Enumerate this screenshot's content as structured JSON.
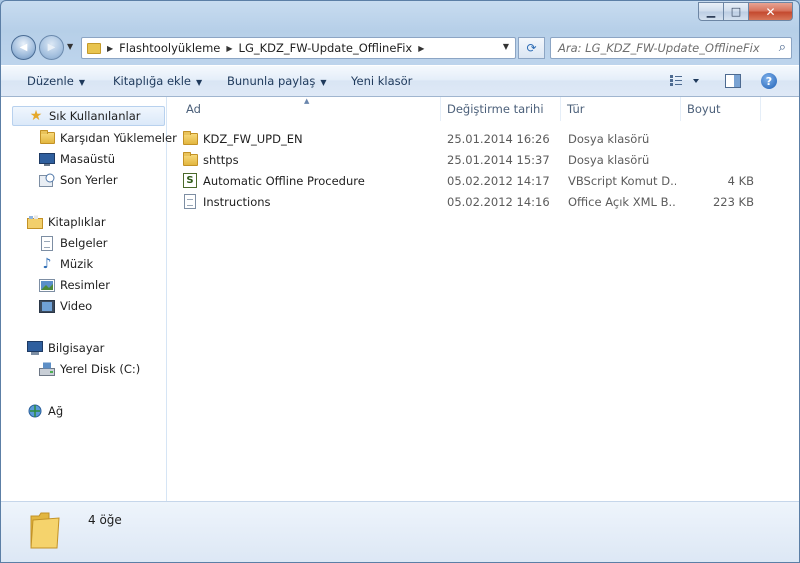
{
  "window": {
    "min_icon": "minimize-icon",
    "max_icon": "maximize-icon",
    "close_icon": "close-icon",
    "min_glyph": "▁",
    "max_glyph": "□",
    "close_glyph": "✕"
  },
  "nav": {
    "back_glyph": "◀",
    "forward_glyph": "▶",
    "history_caret": "▼"
  },
  "address": {
    "sep": "▶",
    "crumbs": [
      "Flashtoolyükleme",
      "LG_KDZ_FW-Update_OfflineFix"
    ],
    "dropdown": "▼",
    "refresh_glyph": "⟳"
  },
  "search": {
    "placeholder": "Ara: LG_KDZ_FW-Update_OfflineFix",
    "icon_glyph": "⌕"
  },
  "toolbar": {
    "organize": "Düzenle",
    "include_library": "Kitaplığa ekle",
    "share_with": "Bununla paylaş",
    "new_folder": "Yeni klasör",
    "caret": "▼",
    "help_glyph": "?"
  },
  "sidebar": {
    "favorites_header": "Sık Kullanılanlar",
    "favorites": [
      "Karşıdan Yüklemeler",
      "Masaüstü",
      "Son Yerler"
    ],
    "libraries_header": "Kitaplıklar",
    "libraries": [
      "Belgeler",
      "Müzik",
      "Resimler",
      "Video"
    ],
    "computer_header": "Bilgisayar",
    "computer": [
      "Yerel Disk (C:)"
    ],
    "network_header": "Ağ"
  },
  "columns": {
    "name": "Ad",
    "date": "Değiştirme tarihi",
    "type": "Tür",
    "size": "Boyut",
    "sort_glyph": "▲"
  },
  "files": [
    {
      "name": "KDZ_FW_UPD_EN",
      "date": "25.01.2014 16:26",
      "type": "Dosya klasörü",
      "size": "",
      "icon": "folder-icon"
    },
    {
      "name": "shttps",
      "date": "25.01.2014 15:37",
      "type": "Dosya klasörü",
      "size": "",
      "icon": "folder-icon"
    },
    {
      "name": "Automatic Offline Procedure",
      "date": "05.02.2012 14:17",
      "type": "VBScript Komut D...",
      "size": "4 KB",
      "icon": "vbscript-icon"
    },
    {
      "name": "Instructions",
      "date": "05.02.2012 14:16",
      "type": "Office Açık XML B...",
      "size": "223 KB",
      "icon": "document-icon"
    }
  ],
  "status": {
    "item_count": "4 öğe"
  }
}
